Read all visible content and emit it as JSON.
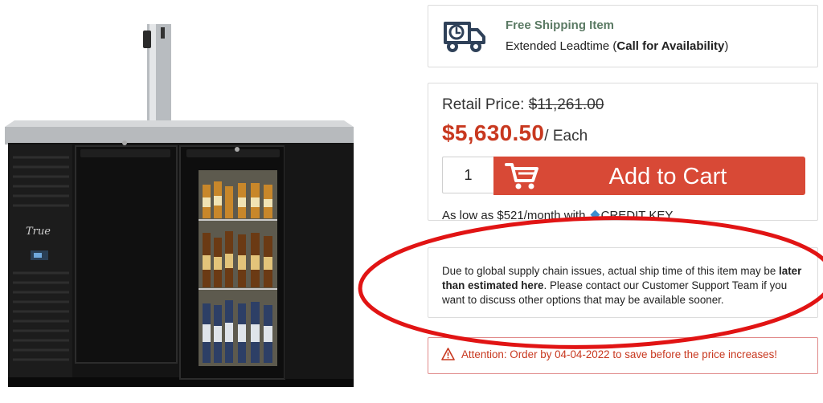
{
  "shipping": {
    "title": "Free Shipping Item",
    "leadtime_prefix": "Extended Leadtime (",
    "leadtime_bold": "Call for Availability",
    "leadtime_suffix": ")",
    "icon": "delivery-truck-clock-icon"
  },
  "pricing": {
    "retail_label": "Retail Price: ",
    "retail_price": "$11,261.00",
    "sale_price": "$5,630.50",
    "unit": "/ Each",
    "quantity": "1",
    "add_to_cart_label": "Add to Cart",
    "financing_prefix": "As low as $521/month with",
    "financing_brand": "CREDIT KEY"
  },
  "notice": {
    "text_1": "Due to global supply chain issues, actual ship time of this item may be ",
    "text_bold": "later than estimated here",
    "text_2": ". Please contact our Customer Support Team if you want to discuss other options that may be available sooner."
  },
  "attention": {
    "text": "Attention: Order by 04-04-2022 to save before the price increases!"
  },
  "product_image": {
    "brand_mark": "True",
    "description": "black back-bar beer dispenser with single-tap tower, one solid door and one glass door showing bottled beverages"
  },
  "colors": {
    "accent_red": "#d84936",
    "price_red": "#c8381f",
    "shipping_green": "#5b7a64",
    "truck_navy": "#2f4159",
    "annotation_red": "#e11414"
  }
}
